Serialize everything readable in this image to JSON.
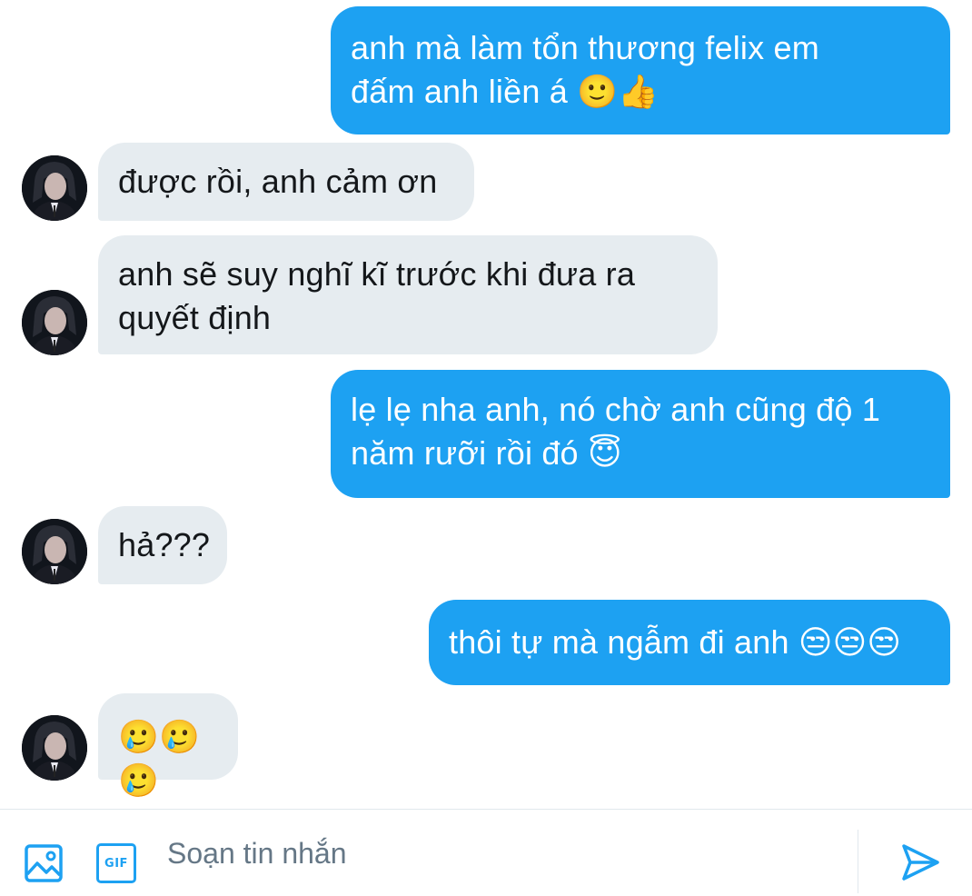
{
  "conversation": {
    "messages": [
      {
        "direction": "outgoing",
        "text": "anh mà làm tổn thương felix em\nđấm anh liền á 🙂👍"
      },
      {
        "direction": "incoming",
        "text": "được rồi, anh cảm ơn"
      },
      {
        "direction": "incoming",
        "text": "anh sẽ suy nghĩ kĩ trước khi đưa ra\nquyết định"
      },
      {
        "direction": "outgoing",
        "text": "lẹ lẹ nha anh, nó chờ anh cũng độ 1\nnăm rưỡi rồi đó 😇"
      },
      {
        "direction": "incoming",
        "text": "hả???"
      },
      {
        "direction": "outgoing",
        "text": "thôi tự mà ngẫm đi anh 😒😒😒"
      },
      {
        "direction": "incoming",
        "text": "🥲🥲🥲"
      }
    ]
  },
  "composer": {
    "placeholder": "Soạn tin nhắn",
    "value": "",
    "media_icon": "image-icon",
    "gif_icon": "gif-icon",
    "gif_label": "GIF",
    "send_icon": "send-icon"
  },
  "colors": {
    "outgoing_bubble": "#1da1f2",
    "incoming_bubble": "#e6ecf0",
    "accent": "#1da1f2"
  }
}
